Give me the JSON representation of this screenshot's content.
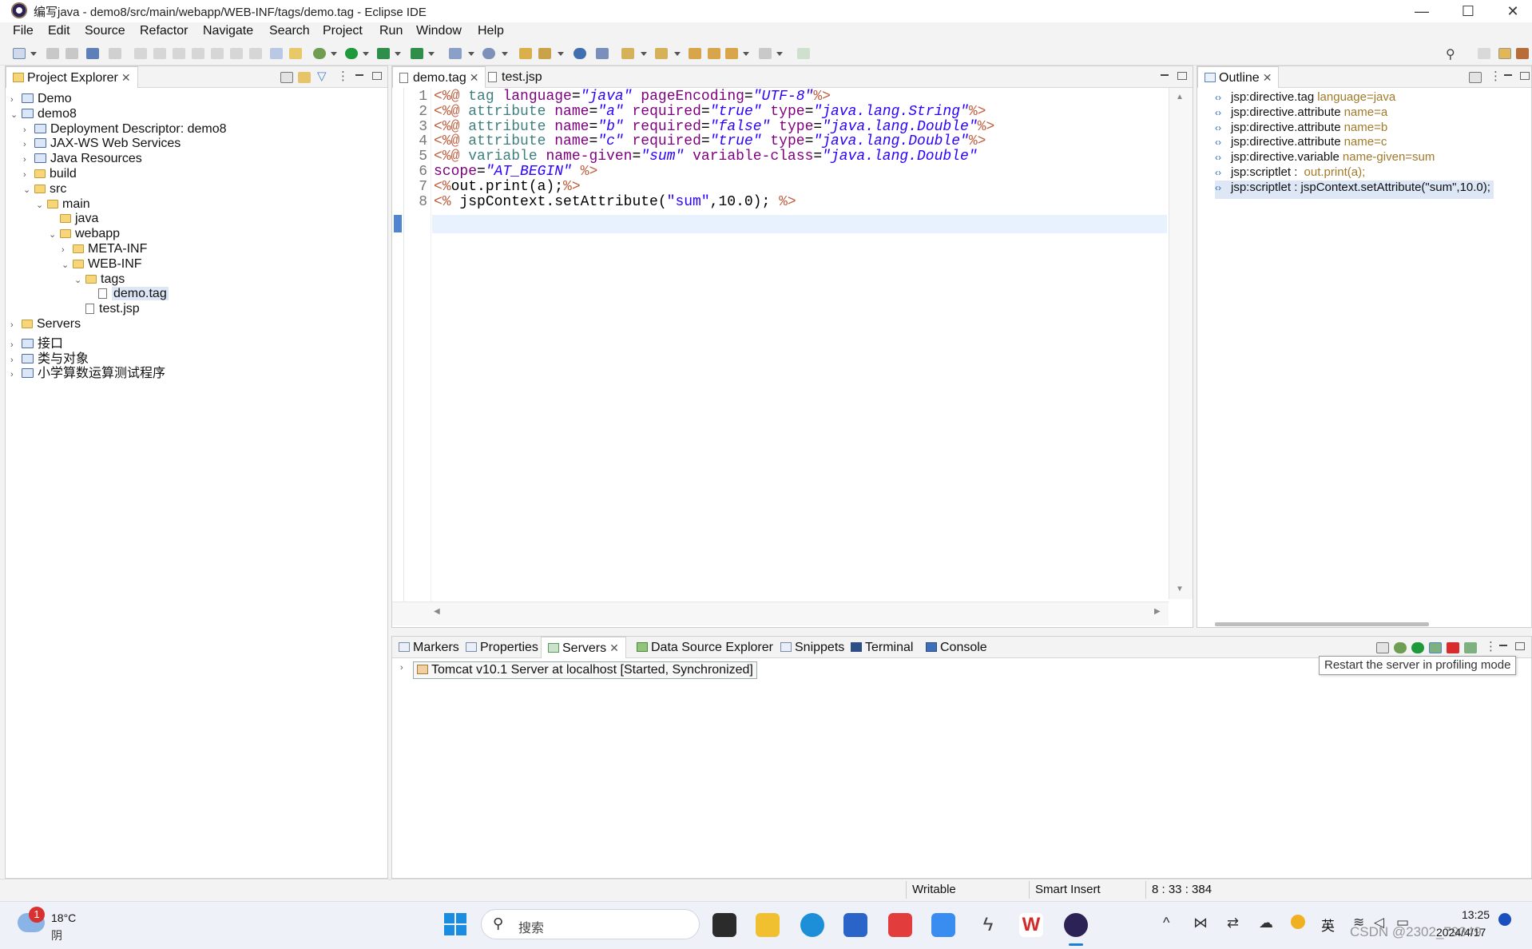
{
  "window": {
    "title": "编写java - demo8/src/main/webapp/WEB-INF/tags/demo.tag - Eclipse IDE",
    "minimize": "—",
    "maximize": "☐",
    "close": "✕"
  },
  "menu": [
    "File",
    "Edit",
    "Source",
    "Refactor",
    "Navigate",
    "Search",
    "Project",
    "Run",
    "Window",
    "Help"
  ],
  "explorer": {
    "tab": "Project Explorer",
    "items": [
      {
        "label": "Demo",
        "twisty": "›",
        "icon": "project"
      },
      {
        "label": "demo8",
        "twisty": "⌄",
        "icon": "project"
      },
      {
        "label": "Deployment Descriptor: demo8",
        "twisty": "›",
        "icon": "descriptor"
      },
      {
        "label": "JAX-WS Web Services",
        "twisty": "›",
        "icon": "webservice"
      },
      {
        "label": "Java Resources",
        "twisty": "›",
        "icon": "java-resources"
      },
      {
        "label": "build",
        "twisty": "›",
        "icon": "folder"
      },
      {
        "label": "src",
        "twisty": "⌄",
        "icon": "folder"
      },
      {
        "label": "main",
        "twisty": "⌄",
        "icon": "folder"
      },
      {
        "label": "java",
        "twisty": "",
        "icon": "folder"
      },
      {
        "label": "webapp",
        "twisty": "⌄",
        "icon": "folder"
      },
      {
        "label": "META-INF",
        "twisty": "›",
        "icon": "folder"
      },
      {
        "label": "WEB-INF",
        "twisty": "⌄",
        "icon": "folder"
      },
      {
        "label": "tags",
        "twisty": "⌄",
        "icon": "folder"
      },
      {
        "label": "demo.tag",
        "twisty": "",
        "icon": "file"
      },
      {
        "label": "test.jsp",
        "twisty": "",
        "icon": "file"
      },
      {
        "label": "Servers",
        "twisty": "›",
        "icon": "folder"
      },
      {
        "label": "接口",
        "twisty": "›",
        "icon": "project"
      },
      {
        "label": "类与对象",
        "twisty": "›",
        "icon": "project"
      },
      {
        "label": "小学算数运算测试程序",
        "twisty": "›",
        "icon": "project"
      }
    ]
  },
  "editor": {
    "tabs": [
      "demo.tag",
      "test.jsp"
    ],
    "lines": [
      {
        "n": "1",
        "parts": [
          [
            "cm",
            "<%@ "
          ],
          [
            "kw",
            "tag "
          ],
          [
            "at",
            "language"
          ],
          [
            "jv",
            "="
          ],
          [
            "str",
            "\"java\""
          ],
          [
            "jv",
            " "
          ],
          [
            "at",
            "pageEncoding"
          ],
          [
            "jv",
            "="
          ],
          [
            "str",
            "\"UTF-8\""
          ],
          [
            "cm",
            "%>"
          ]
        ]
      },
      {
        "n": "2",
        "parts": [
          [
            "cm",
            "<%@ "
          ],
          [
            "kw",
            "attribute "
          ],
          [
            "at",
            "name"
          ],
          [
            "jv",
            "="
          ],
          [
            "str",
            "\"a\""
          ],
          [
            "jv",
            " "
          ],
          [
            "at",
            "required"
          ],
          [
            "jv",
            "="
          ],
          [
            "str",
            "\"true\""
          ],
          [
            "jv",
            " "
          ],
          [
            "at",
            "type"
          ],
          [
            "jv",
            "="
          ],
          [
            "str",
            "\"java.lang.String\""
          ],
          [
            "cm",
            "%>"
          ]
        ]
      },
      {
        "n": "3",
        "parts": [
          [
            "cm",
            "<%@ "
          ],
          [
            "kw",
            "attribute "
          ],
          [
            "at",
            "name"
          ],
          [
            "jv",
            "="
          ],
          [
            "str",
            "\"b\""
          ],
          [
            "jv",
            " "
          ],
          [
            "at",
            "required"
          ],
          [
            "jv",
            "="
          ],
          [
            "str",
            "\"false\""
          ],
          [
            "jv",
            " "
          ],
          [
            "at",
            "type"
          ],
          [
            "jv",
            "="
          ],
          [
            "str",
            "\"java.lang.Double\""
          ],
          [
            "cm",
            "%>"
          ]
        ]
      },
      {
        "n": "4",
        "parts": [
          [
            "cm",
            "<%@ "
          ],
          [
            "kw",
            "attribute "
          ],
          [
            "at",
            "name"
          ],
          [
            "jv",
            "="
          ],
          [
            "str",
            "\"c\""
          ],
          [
            "jv",
            " "
          ],
          [
            "at",
            "required"
          ],
          [
            "jv",
            "="
          ],
          [
            "str",
            "\"true\""
          ],
          [
            "jv",
            " "
          ],
          [
            "at",
            "type"
          ],
          [
            "jv",
            "="
          ],
          [
            "str",
            "\"java.lang.Double\""
          ],
          [
            "cm",
            "%>"
          ]
        ]
      },
      {
        "n": "5",
        "parts": [
          [
            "cm",
            "<%@ "
          ],
          [
            "kw",
            "variable "
          ],
          [
            "at",
            "name-given"
          ],
          [
            "jv",
            "="
          ],
          [
            "str",
            "\"sum\""
          ],
          [
            "jv",
            " "
          ],
          [
            "at",
            "variable-class"
          ],
          [
            "jv",
            "="
          ],
          [
            "str",
            "\"java.lang.Double\""
          ]
        ]
      },
      {
        "n": "6",
        "parts": [
          [
            "at",
            "scope"
          ],
          [
            "jv",
            "="
          ],
          [
            "str",
            "\"AT_BEGIN\""
          ],
          [
            "jv",
            " "
          ],
          [
            "cm",
            "%>"
          ]
        ]
      },
      {
        "n": "7",
        "parts": [
          [
            "cm",
            "<%"
          ],
          [
            "jv",
            "out.print(a);"
          ],
          [
            "cm",
            "%>"
          ]
        ]
      },
      {
        "n": "8",
        "parts": [
          [
            "cm",
            "<%"
          ],
          [
            "jv",
            " jspContext.setAttribute("
          ],
          [
            "str2",
            "\"sum\""
          ],
          [
            "jv",
            ",10.0); "
          ],
          [
            "cm",
            "%>"
          ]
        ]
      }
    ]
  },
  "outline": {
    "tab": "Outline",
    "items": [
      {
        "main": "jsp:directive.tag",
        "sub": "language=java"
      },
      {
        "main": "jsp:directive.attribute",
        "sub": "name=a"
      },
      {
        "main": "jsp:directive.attribute",
        "sub": "name=b"
      },
      {
        "main": "jsp:directive.attribute",
        "sub": "name=c"
      },
      {
        "main": "jsp:directive.variable",
        "sub": "name-given=sum"
      },
      {
        "main": "jsp:scriptlet : ",
        "sub": "out.print(a);"
      },
      {
        "main": "jsp:scriptlet : jspContext.setAttribute(\"sum\",10.0);",
        "sub": ""
      }
    ]
  },
  "bottom": {
    "tabs": [
      "Markers",
      "Properties",
      "Servers",
      "Data Source Explorer",
      "Snippets",
      "Terminal",
      "Console"
    ],
    "server": "Tomcat v10.1 Server at localhost  [Started, Synchronized]",
    "tooltip": "Restart the server in profiling mode"
  },
  "status": {
    "writable": "Writable",
    "insert": "Smart Insert",
    "position": "8 : 33 : 384"
  },
  "taskbar": {
    "weather_temp": "18°C",
    "weather_desc": "阴",
    "weather_badge": "1",
    "search": "搜索",
    "ime": "英",
    "time": "13:25",
    "date": "2024/4/17",
    "watermark": "CSDN @2302_79349"
  },
  "colors": {
    "accent": "#2a6bb6",
    "selection": "#dde7f6",
    "current_line": "#e8f2fe"
  }
}
